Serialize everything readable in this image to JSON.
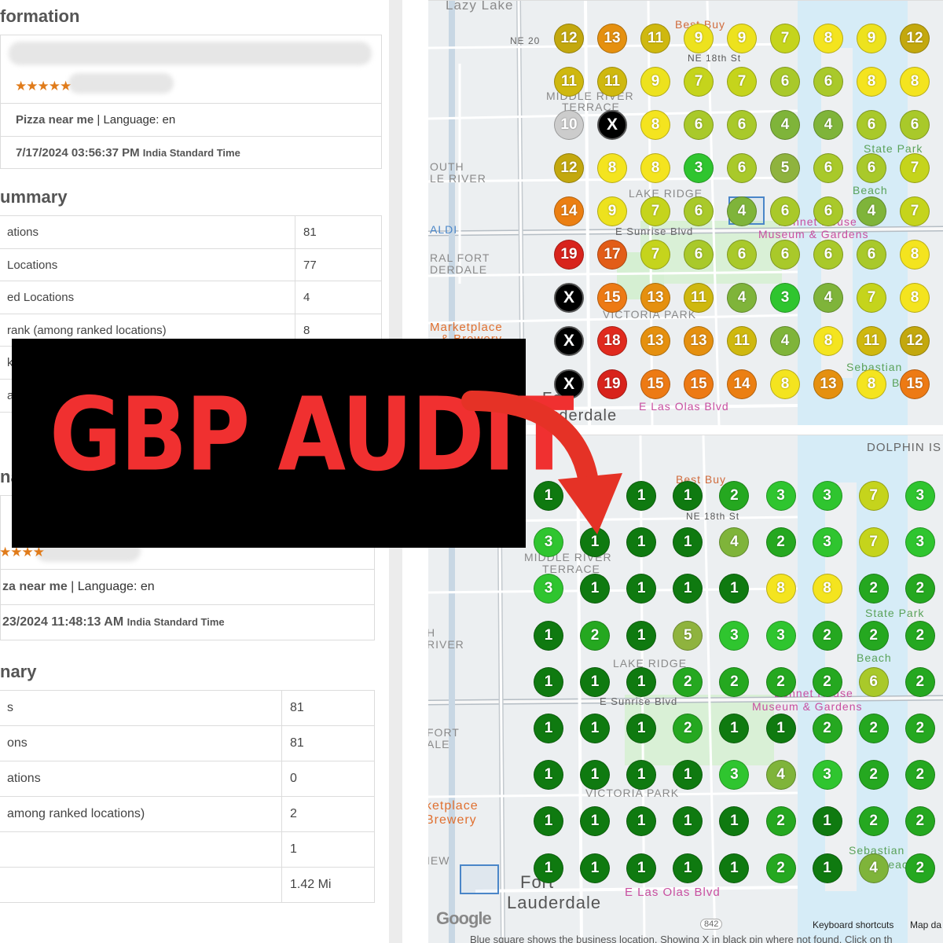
{
  "before": {
    "section_title": "formation",
    "rating_stars": "★★★★★",
    "keyword": "Pizza near me",
    "language": " | Language: en",
    "date": "7/17/2024 03:56:37 PM",
    "timezone": "India Standard Time",
    "summary_title": "ummary",
    "rows": [
      {
        "label": "ations",
        "value": "81"
      },
      {
        "label": "Locations",
        "value": "77"
      },
      {
        "label": "ed Locations",
        "value": "4"
      },
      {
        "label": "rank (among ranked locations)",
        "value": "8"
      },
      {
        "label": "k",
        "value": ""
      },
      {
        "label": "an",
        "value": ""
      }
    ]
  },
  "after": {
    "section_title": "na",
    "rating_stars": "★★★★",
    "keyword": "za near me",
    "language": " | Language: en",
    "date": "23/2024 11:48:13 AM",
    "timezone": "India Standard Time",
    "summary_title": "nary",
    "rows": [
      {
        "label": "s",
        "value": "81"
      },
      {
        "label": "ons",
        "value": "81"
      },
      {
        "label": "ations",
        "value": "0"
      },
      {
        "label": "among ranked locations)",
        "value": "2"
      },
      {
        "label": "",
        "value": "1"
      },
      {
        "label": "",
        "value": "1.42 Mi"
      }
    ]
  },
  "banner": {
    "title": "GBP AUDIT"
  },
  "map_top": {
    "labels": [
      "Lazy Lake",
      "NE 20",
      "Best Buy",
      "NE 18th St",
      "MIDDLE RIVER",
      "TERRACE",
      "OUTH",
      "LE RIVER",
      "LAKE RIDGE",
      "E Sunrise Blvd",
      "Bonnet House",
      "Museum & Gardens",
      "RAL FORT",
      "DERDALE",
      "Marketplace",
      "& Brewery",
      "VICTORIA PARK",
      "Fort",
      "Lauderdale",
      "E Las Olas Blvd",
      "Sebastian",
      "Beach",
      "State Park",
      "Beach",
      "ALDI"
    ],
    "grid": [
      [
        "12",
        "13",
        "11",
        "9",
        "9",
        "7",
        "8",
        "9",
        "12"
      ],
      [
        "11",
        "11",
        "9",
        "7",
        "7",
        "6",
        "6",
        "8",
        "8"
      ],
      [
        "10",
        "X",
        "8",
        "6",
        "6",
        "4",
        "4",
        "6",
        "6"
      ],
      [
        "12",
        "8",
        "8",
        "3",
        "6",
        "5",
        "6",
        "6",
        "7"
      ],
      [
        "14",
        "9",
        "7",
        "6",
        "4",
        "6",
        "6",
        "4",
        "7"
      ],
      [
        "19",
        "17",
        "7",
        "6",
        "6",
        "6",
        "6",
        "6",
        "8"
      ],
      [
        "X",
        "15",
        "13",
        "11",
        "4",
        "3",
        "4",
        "7",
        "8"
      ],
      [
        "X",
        "18",
        "13",
        "13",
        "11",
        "4",
        "8",
        "11",
        "12"
      ],
      [
        "X",
        "19",
        "15",
        "15",
        "14",
        "8",
        "13",
        "8",
        "15"
      ]
    ]
  },
  "map_bottom": {
    "labels": [
      "DOLPHIN IS",
      "Best Buy",
      "NE 18th St",
      "MIDDLE RIVER",
      "TERRACE",
      "H",
      "RIVER",
      "LAKE RIDGE",
      "E Sunrise Blvd",
      "Bonnet House",
      "Museum & Gardens",
      "FORT",
      "ALE",
      "ketplace",
      "Brewery",
      "VICTORIA PARK",
      "IEW",
      "Fort",
      "Lauderdale",
      "E Las Olas Blvd",
      "Sebastian",
      "Beach",
      "State Park",
      "Beach"
    ],
    "grid": [
      [
        "1",
        "1",
        "1",
        "1",
        "2",
        "3",
        "3",
        "7",
        "3"
      ],
      [
        "3",
        "1",
        "1",
        "1",
        "4",
        "2",
        "3",
        "7",
        "3"
      ],
      [
        "3",
        "1",
        "1",
        "1",
        "1",
        "8",
        "8",
        "2",
        "2"
      ],
      [
        "1",
        "2",
        "1",
        "5",
        "3",
        "3",
        "2",
        "2",
        "2"
      ],
      [
        "1",
        "1",
        "1",
        "2",
        "2",
        "2",
        "2",
        "6",
        "2"
      ],
      [
        "1",
        "1",
        "1",
        "2",
        "1",
        "1",
        "2",
        "2",
        "2"
      ],
      [
        "1",
        "1",
        "1",
        "1",
        "3",
        "4",
        "3",
        "2",
        "2"
      ],
      [
        "1",
        "1",
        "1",
        "1",
        "1",
        "2",
        "1",
        "2",
        "2"
      ],
      [
        "1",
        "1",
        "1",
        "1",
        "1",
        "2",
        "1",
        "4",
        "2"
      ]
    ],
    "google": "Google",
    "shortcuts": "Keyboard shortcuts",
    "mapdata": "Map da",
    "route_badge": "842"
  },
  "footer_note": "Blue square shows the business location. Showing X in black pin where not found. Click on th",
  "colors": {
    "rank1": "#0f7a10",
    "rank2": "#25a820",
    "rank3": "#2fc52f",
    "rank4": "#7fb43a",
    "rank5": "#8fb33e",
    "rank6": "#a9c92a",
    "rank7": "#c5d41c",
    "rank8": "#f4e41f",
    "rank9": "#ede21e",
    "rank11": "#cfb80f",
    "rank12": "#c3a80e",
    "rank13": "#e5900f",
    "rank14": "#eb7f12",
    "rank15": "#ed7a14",
    "rank17": "#e25d18",
    "rank18": "#e02a1e",
    "rank19": "#d8231c",
    "notfound": "#000000",
    "banner_text": "#f03030"
  }
}
